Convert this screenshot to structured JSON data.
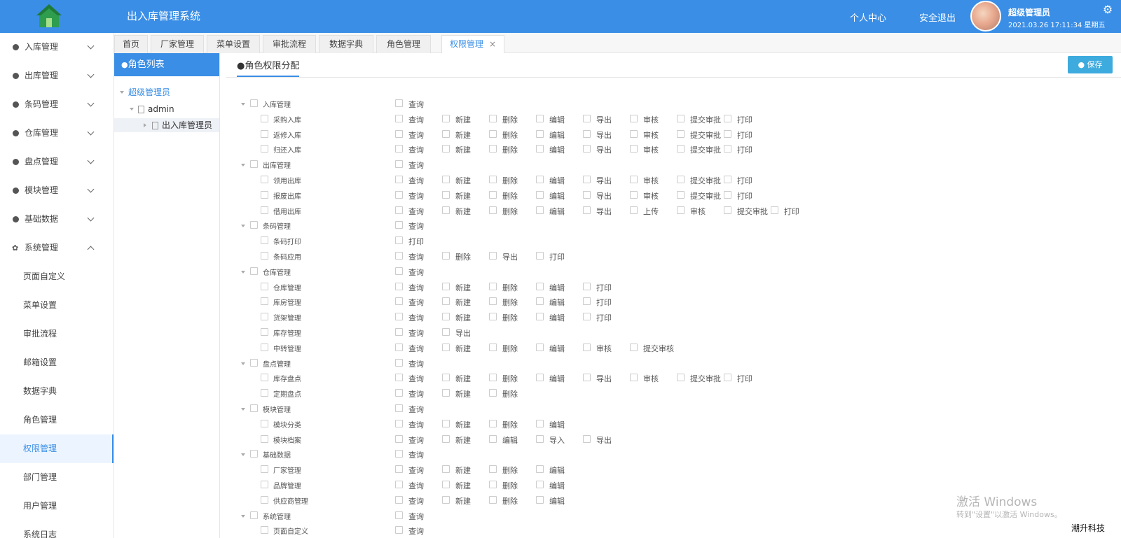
{
  "header": {
    "app_title": "出入库管理系统",
    "personal_center": "个人中心",
    "logout": "安全退出",
    "user_name": "超级管理员",
    "datetime": "2021.03.26 17:11:34 星期五"
  },
  "sidebar": {
    "items": [
      {
        "label": "入库管理"
      },
      {
        "label": "出库管理"
      },
      {
        "label": "条码管理"
      },
      {
        "label": "仓库管理"
      },
      {
        "label": "盘点管理"
      },
      {
        "label": "模块管理"
      },
      {
        "label": "基础数据"
      },
      {
        "label": "系统管理"
      }
    ],
    "sub_items": [
      {
        "label": "页面自定义"
      },
      {
        "label": "菜单设置"
      },
      {
        "label": "审批流程"
      },
      {
        "label": "邮箱设置"
      },
      {
        "label": "数据字典"
      },
      {
        "label": "角色管理"
      },
      {
        "label": "权限管理"
      },
      {
        "label": "部门管理"
      },
      {
        "label": "用户管理"
      },
      {
        "label": "系统日志"
      }
    ]
  },
  "tabs": [
    {
      "label": "首页"
    },
    {
      "label": "厂家管理"
    },
    {
      "label": "菜单设置"
    },
    {
      "label": "审批流程"
    },
    {
      "label": "数据字典"
    },
    {
      "label": "角色管理"
    },
    {
      "label": "权限管理"
    }
  ],
  "role_panel": {
    "title": "角色列表",
    "tree": {
      "root": "超级管理员",
      "child": "admin",
      "grandchild": "出入库管理员"
    }
  },
  "permission": {
    "tab_title": "角色权限分配",
    "save_label": "保存",
    "rows": [
      {
        "label": "入库管理",
        "group": true,
        "perms": [
          "查询"
        ]
      },
      {
        "label": "采购入库",
        "perms": [
          "查询",
          "新建",
          "删除",
          "编辑",
          "导出",
          "审核",
          "提交审批",
          "打印"
        ]
      },
      {
        "label": "返修入库",
        "perms": [
          "查询",
          "新建",
          "删除",
          "编辑",
          "导出",
          "审核",
          "提交审批",
          "打印"
        ]
      },
      {
        "label": "归还入库",
        "perms": [
          "查询",
          "新建",
          "删除",
          "编辑",
          "导出",
          "审核",
          "提交审批",
          "打印"
        ]
      },
      {
        "label": "出库管理",
        "group": true,
        "perms": [
          "查询"
        ]
      },
      {
        "label": "领用出库",
        "perms": [
          "查询",
          "新建",
          "删除",
          "编辑",
          "导出",
          "审核",
          "提交审批",
          "打印"
        ]
      },
      {
        "label": "报废出库",
        "perms": [
          "查询",
          "新建",
          "删除",
          "编辑",
          "导出",
          "审核",
          "提交审批",
          "打印"
        ]
      },
      {
        "label": "借用出库",
        "perms": [
          "查询",
          "新建",
          "删除",
          "编辑",
          "导出",
          "上传",
          "审核",
          "提交审批",
          "打印"
        ]
      },
      {
        "label": "条码管理",
        "group": true,
        "perms": [
          "查询"
        ]
      },
      {
        "label": "条码打印",
        "perms": [
          "打印"
        ]
      },
      {
        "label": "条码应用",
        "perms": [
          "查询",
          "删除",
          "导出",
          "打印"
        ]
      },
      {
        "label": "仓库管理",
        "group": true,
        "perms": [
          "查询"
        ]
      },
      {
        "label": "仓库管理",
        "perms": [
          "查询",
          "新建",
          "删除",
          "编辑",
          "打印"
        ]
      },
      {
        "label": "库房管理",
        "perms": [
          "查询",
          "新建",
          "删除",
          "编辑",
          "打印"
        ]
      },
      {
        "label": "货架管理",
        "perms": [
          "查询",
          "新建",
          "删除",
          "编辑",
          "打印"
        ]
      },
      {
        "label": "库存管理",
        "perms": [
          "查询",
          "导出"
        ]
      },
      {
        "label": "中转管理",
        "perms": [
          "查询",
          "新建",
          "删除",
          "编辑",
          "审核",
          "提交审核"
        ]
      },
      {
        "label": "盘点管理",
        "group": true,
        "perms": [
          "查询"
        ]
      },
      {
        "label": "库存盘点",
        "perms": [
          "查询",
          "新建",
          "删除",
          "编辑",
          "导出",
          "审核",
          "提交审批",
          "打印"
        ]
      },
      {
        "label": "定期盘点",
        "perms": [
          "查询",
          "新建",
          "删除"
        ]
      },
      {
        "label": "模块管理",
        "group": true,
        "perms": [
          "查询"
        ]
      },
      {
        "label": "模块分类",
        "perms": [
          "查询",
          "新建",
          "删除",
          "编辑"
        ]
      },
      {
        "label": "模块档案",
        "perms": [
          "查询",
          "新建",
          "编辑",
          "导入",
          "导出"
        ]
      },
      {
        "label": "基础数据",
        "group": true,
        "perms": [
          "查询"
        ]
      },
      {
        "label": "厂家管理",
        "perms": [
          "查询",
          "新建",
          "删除",
          "编辑"
        ]
      },
      {
        "label": "品牌管理",
        "perms": [
          "查询",
          "新建",
          "删除",
          "编辑"
        ]
      },
      {
        "label": "供应商管理",
        "perms": [
          "查询",
          "新建",
          "删除",
          "编辑"
        ]
      },
      {
        "label": "系统管理",
        "group": true,
        "perms": [
          "查询"
        ]
      },
      {
        "label": "页面自定义",
        "perms": [
          "查询"
        ]
      }
    ]
  },
  "watermark": {
    "line1": "激活 Windows",
    "line2": "转到\"设置\"以激活 Windows。"
  },
  "corner_brand": "潮升科技",
  "colors": {
    "primary": "#3a8ee6",
    "save_button": "#3dabde"
  }
}
